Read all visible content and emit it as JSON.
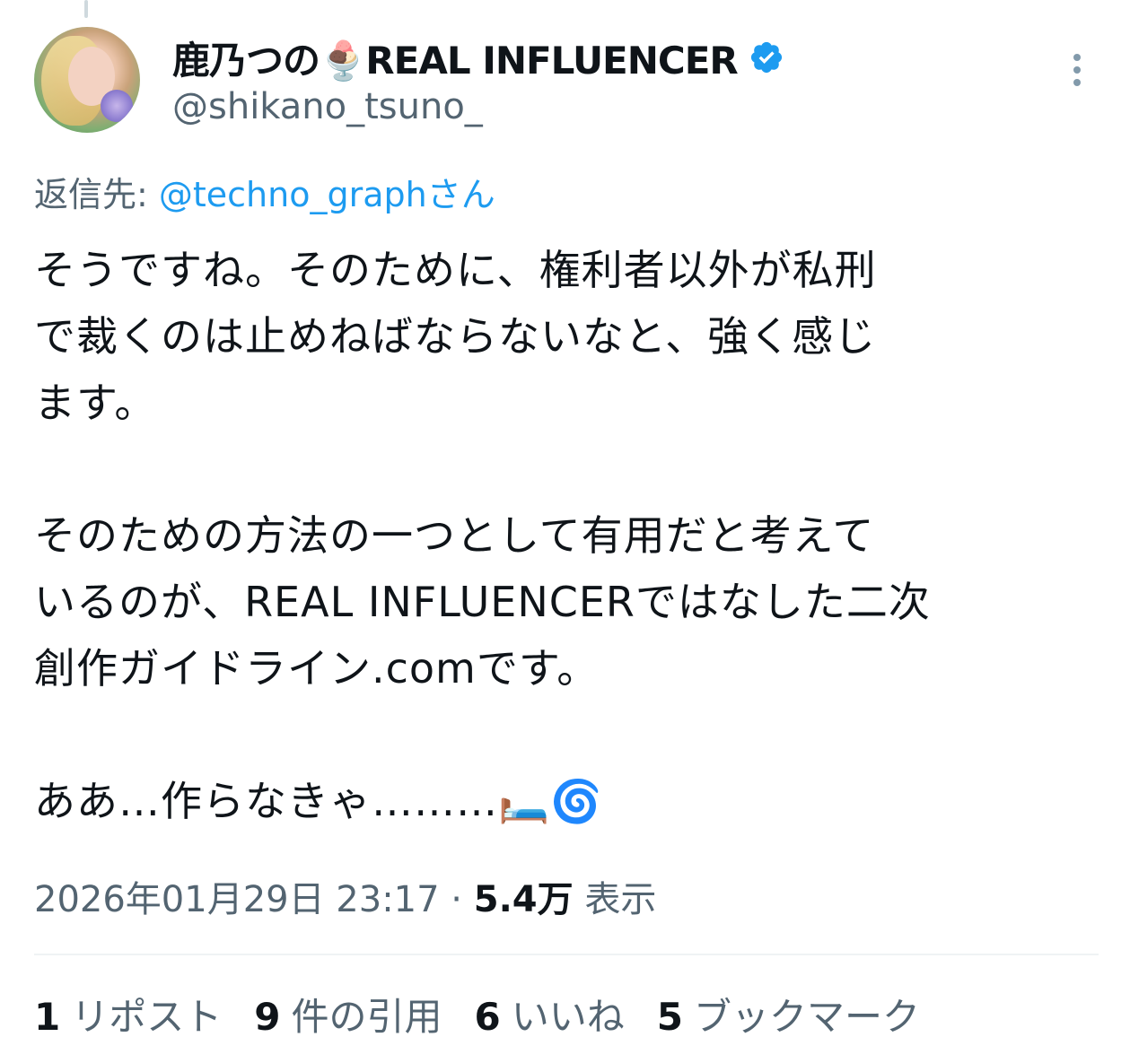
{
  "author": {
    "display_name": "鹿乃つの🍨REAL INFLUENCER",
    "handle": "@shikano_tsuno_"
  },
  "reply": {
    "prefix": "返信先: ",
    "mention": "@techno_graphさん"
  },
  "tweet": {
    "text": "そうですね。そのために、権利者以外が私刑\nで裁くのは止めねばならないなと、強く感じ\nます。\n\nそのための方法の一つとして有用だと考えて\nいるのが、REAL INFLUENCERではなした二次\n創作ガイドライン.comです。\n\nああ…作らなきゃ………🛏️🌀"
  },
  "meta": {
    "timestamp": "2026年01月29日 23:17",
    "separator": " · ",
    "views_count": "5.4万",
    "views_label": " 表示"
  },
  "stats": [
    {
      "num": "1",
      "label": "リポスト"
    },
    {
      "num": "9",
      "label": "件の引用"
    },
    {
      "num": "6",
      "label": "いいね"
    },
    {
      "num": "5",
      "label": "ブックマーク"
    }
  ],
  "colors": {
    "verified": "#1d9bf0",
    "link": "#1d9bf0",
    "secondary_text": "#536471",
    "primary_text": "#0f1419"
  },
  "icons": {
    "verified": "verified-badge-icon",
    "more": "more-options-icon"
  }
}
